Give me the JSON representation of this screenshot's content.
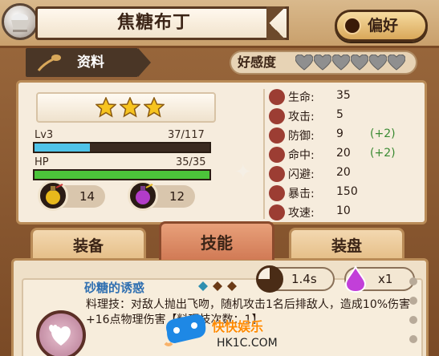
{
  "header": {
    "title": "焦糖布丁",
    "favorite_label": "偏好"
  },
  "info_tab": {
    "label": "资料"
  },
  "affinity": {
    "label": "好感度",
    "hearts_total": 6,
    "hearts_filled": 0
  },
  "character": {
    "stars": 3,
    "level_label": "Lv3",
    "exp_text": "37/117",
    "exp_fraction": 0.316,
    "hp_label": "HP",
    "hp_text": "35/35",
    "hp_fraction": 1.0,
    "resources": [
      {
        "icon": "potion-yellow-icon",
        "value": "14"
      },
      {
        "icon": "potion-purple-icon",
        "value": "12"
      }
    ]
  },
  "stats": [
    {
      "icon": "heart-icon",
      "name": "生命:",
      "value": "35",
      "bonus": ""
    },
    {
      "icon": "attack-icon",
      "name": "攻击:",
      "value": "5",
      "bonus": ""
    },
    {
      "icon": "shield-icon",
      "name": "防御:",
      "value": "9",
      "bonus": "(+2)"
    },
    {
      "icon": "crosshair-icon",
      "name": "命中:",
      "value": "20",
      "bonus": "(+2)"
    },
    {
      "icon": "dodge-icon",
      "name": "闪避:",
      "value": "20",
      "bonus": ""
    },
    {
      "icon": "crit-icon",
      "name": "暴击:",
      "value": "150",
      "bonus": ""
    },
    {
      "icon": "speed-icon",
      "name": "攻速:",
      "value": "10",
      "bonus": ""
    }
  ],
  "tabs": [
    {
      "label": "装备",
      "active": false
    },
    {
      "label": "技能",
      "active": true
    },
    {
      "label": "装盘",
      "active": false
    }
  ],
  "skill": {
    "name": "砂糖的诱惑",
    "cooldown": "1.4s",
    "cost": "x1",
    "description": "料理技：对敌人抛出飞吻，随机攻击1名后排敌人，造成10%伤害+16点物理伤害【料理技次数：1】"
  },
  "watermark": {
    "text": "快快娱乐",
    "url": "HK1C.COM"
  },
  "colors": {
    "exp_bar": "#4fc3e8",
    "hp_bar": "#4cc43a",
    "skill_name": "#2f6fb1",
    "bonus": "#3a8a32"
  }
}
